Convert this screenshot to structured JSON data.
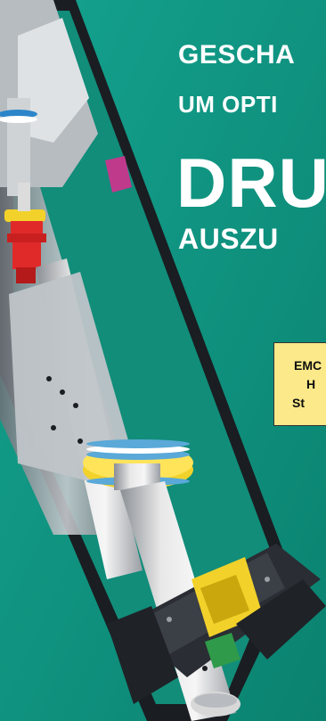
{
  "headline": {
    "line1": "GESCHA",
    "line2": "UM OPTI"
  },
  "title": {
    "main": "DRU",
    "sub": "AUSZU"
  },
  "info_box": {
    "line1": "EMC",
    "line2": "H",
    "line3": "St"
  },
  "colors": {
    "background": "#0f9380",
    "text": "#ffffff",
    "info_box": "#fbe98a",
    "cylinder_body": "#d9d9d9",
    "ring_yellow": "#f2d22a",
    "fitting_red": "#e02a2a",
    "base_dark": "#2a2d33"
  }
}
